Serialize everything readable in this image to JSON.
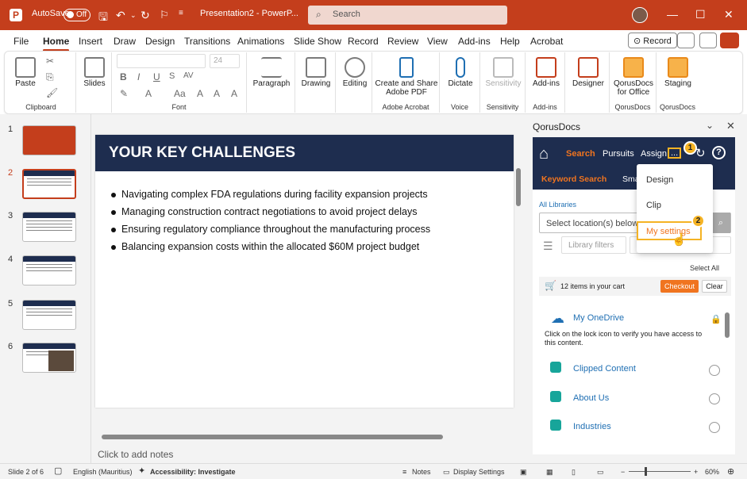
{
  "titlebar": {
    "autosave_label": "AutoSave",
    "autosave_state": "Off",
    "filename": "Presentation2 - PowerP...",
    "search_placeholder": "Search"
  },
  "menu": {
    "tabs": [
      "File",
      "Home",
      "Insert",
      "Draw",
      "Design",
      "Transitions",
      "Animations",
      "Slide Show",
      "Record",
      "Review",
      "View",
      "Add-ins",
      "Help",
      "Acrobat"
    ],
    "active": "Home",
    "record_button": "Record"
  },
  "ribbon": {
    "paste": "Paste",
    "slides": "Slides",
    "paragraph": "Paragraph",
    "drawing": "Drawing",
    "editing": "Editing",
    "create_share": "Create and Share Adobe PDF",
    "dictate": "Dictate",
    "sensitivity": "Sensitivity",
    "addins": "Add-ins",
    "designer": "Designer",
    "qorusdocs": "QorusDocs for Office",
    "staging": "Staging",
    "font_size": "24",
    "group_labels": {
      "clipboard": "Clipboard",
      "font": "Font",
      "adobe": "Adobe Acrobat",
      "voice": "Voice",
      "sensitivity": "Sensitivity",
      "addins": "Add-ins",
      "qorus1": "QorusDocs",
      "qorus2": "QorusDocs"
    }
  },
  "thumbnails": [
    "1",
    "2",
    "3",
    "4",
    "5",
    "6"
  ],
  "slide": {
    "title": "YOUR KEY CHALLENGES",
    "bullets": [
      "Navigating complex FDA regulations during facility expansion projects",
      "Managing construction contract negotiations to avoid project delays",
      "Ensuring regulatory compliance throughout the manufacturing process",
      "Balancing expansion costs within the allocated $60M project budget"
    ],
    "notes_placeholder": "Click to add notes"
  },
  "panel": {
    "title": "QorusDocs",
    "nav": {
      "search": "Search",
      "pursuits": "Pursuits",
      "assign": "Assign",
      "more": "..."
    },
    "subnav": {
      "keyword": "Keyword Search",
      "smart": "Sma"
    },
    "all_libraries": "All Libraries",
    "location_placeholder": "Select location(s) below",
    "library_filters": "Library filters",
    "select_all": "Select All",
    "cart_text": "12 items in your cart",
    "checkout": "Checkout",
    "clear": "Clear",
    "onedrive": "My OneDrive",
    "lock_message": "Click on the lock icon to verify you have access to this content.",
    "libraries": [
      "Clipped Content",
      "About Us",
      "Industries"
    ],
    "dropdown": [
      "Design",
      "Clip",
      "My settings"
    ],
    "badges": [
      "1",
      "2"
    ]
  },
  "status": {
    "slide_of": "Slide 2 of 6",
    "language": "English (Mauritius)",
    "accessibility": "Accessibility: Investigate",
    "notes": "Notes",
    "display": "Display Settings",
    "zoom": "60%"
  },
  "colors": {
    "accent": "#c43e1c",
    "navy": "#1e2d4f",
    "orange": "#f0741f",
    "highlight": "#f5b324"
  }
}
